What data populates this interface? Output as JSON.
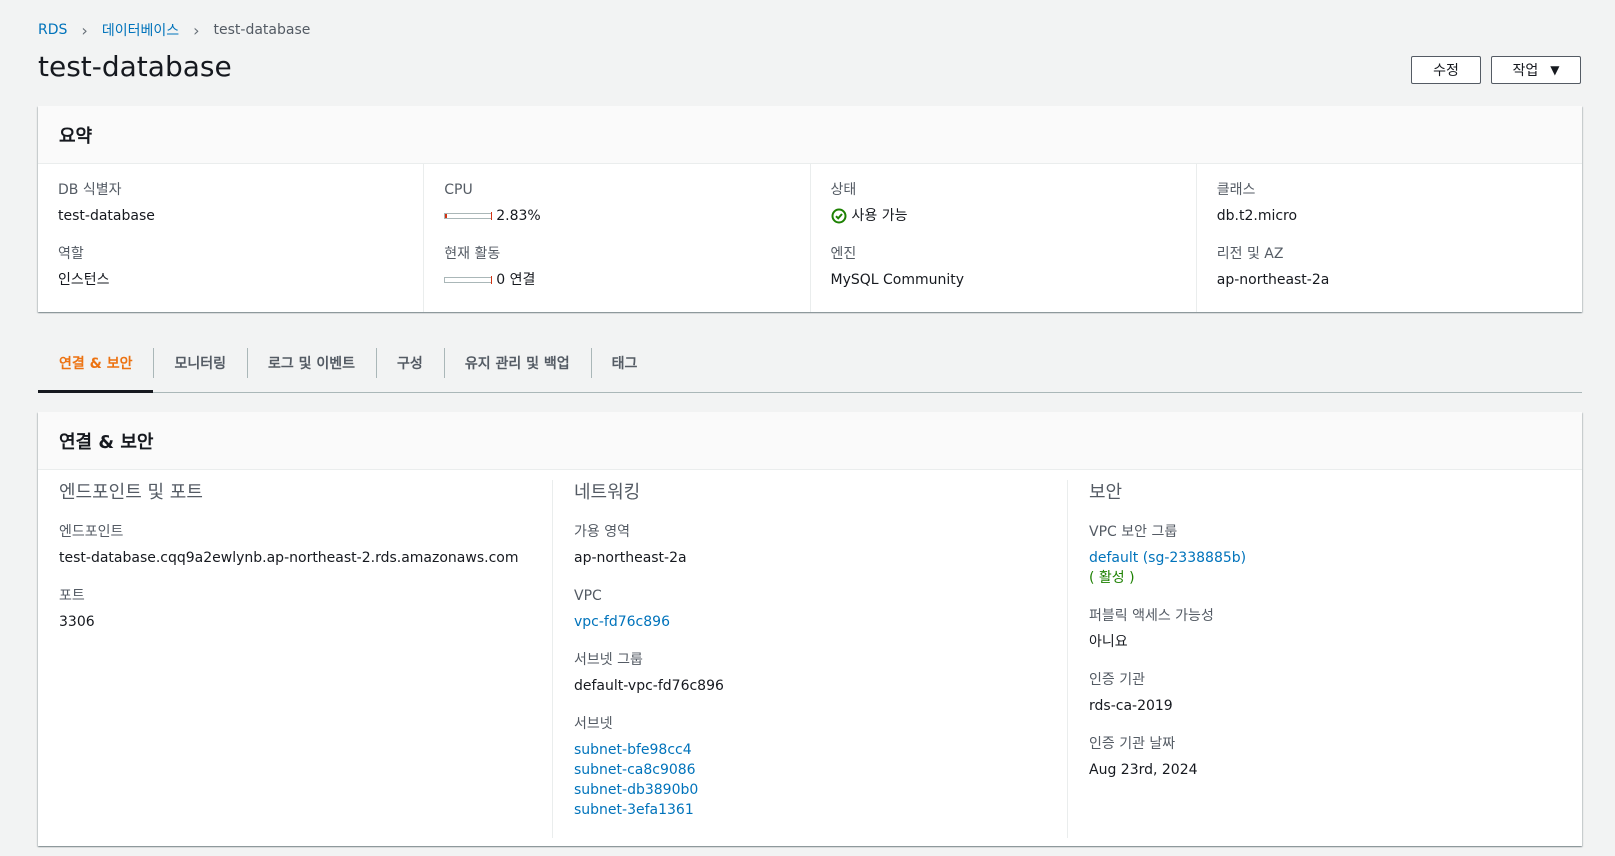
{
  "breadcrumb": {
    "items": [
      {
        "label": "RDS"
      },
      {
        "label": "데이터베이스"
      },
      {
        "label": "test-database"
      }
    ]
  },
  "page": {
    "title": "test-database",
    "edit_button": "수정",
    "actions_button": "작업"
  },
  "summary": {
    "header": "요약",
    "db_identifier": {
      "label": "DB 식별자",
      "value": "test-database"
    },
    "role": {
      "label": "역할",
      "value": "인스턴스"
    },
    "cpu": {
      "label": "CPU",
      "value": "2.83%",
      "fraction": 0.0283
    },
    "activity": {
      "label": "현재 활동",
      "value": "0 연결",
      "fraction": 0
    },
    "status": {
      "label": "상태",
      "value": "사용 가능",
      "icon": "check-circle-icon"
    },
    "engine": {
      "label": "엔진",
      "value": "MySQL Community"
    },
    "class": {
      "label": "클래스",
      "value": "db.t2.micro"
    },
    "region": {
      "label": "리전 및 AZ",
      "value": "ap-northeast-2a"
    }
  },
  "tabs": [
    {
      "label": "연결 & 보안",
      "active": true
    },
    {
      "label": "모니터링",
      "active": false
    },
    {
      "label": "로그 및 이벤트",
      "active": false
    },
    {
      "label": "구성",
      "active": false
    },
    {
      "label": "유지 관리 및 백업",
      "active": false
    },
    {
      "label": "태그",
      "active": false
    }
  ],
  "connectivity": {
    "header": "연결 & 보안",
    "endpoint_section": {
      "title": "엔드포인트 및 포트",
      "endpoint": {
        "label": "엔드포인트",
        "value": "test-database.cqq9a2ewlynb.ap-northeast-2.rds.amazonaws.com"
      },
      "port": {
        "label": "포트",
        "value": "3306"
      }
    },
    "networking_section": {
      "title": "네트워킹",
      "az": {
        "label": "가용 영역",
        "value": "ap-northeast-2a"
      },
      "vpc": {
        "label": "VPC",
        "value": "vpc-fd76c896"
      },
      "subnet_group": {
        "label": "서브넷 그룹",
        "value": "default-vpc-fd76c896"
      },
      "subnets": {
        "label": "서브넷",
        "values": [
          "subnet-bfe98cc4",
          "subnet-ca8c9086",
          "subnet-db3890b0",
          "subnet-3efa1361"
        ]
      }
    },
    "security_section": {
      "title": "보안",
      "vpc_sg": {
        "label": "VPC 보안 그룹",
        "value": "default (sg-2338885b)",
        "status": "( 활성 )"
      },
      "public_access": {
        "label": "퍼블릭 액세스 가능성",
        "value": "아니요"
      },
      "ca": {
        "label": "인증 기관",
        "value": "rds-ca-2019"
      },
      "ca_date": {
        "label": "인증 기관 날짜",
        "value": "Aug 23rd, 2024"
      }
    }
  },
  "colors": {
    "link": "#0073bb",
    "success": "#1d8102",
    "tab_active": "#ec7211",
    "meter": "#d13212"
  }
}
